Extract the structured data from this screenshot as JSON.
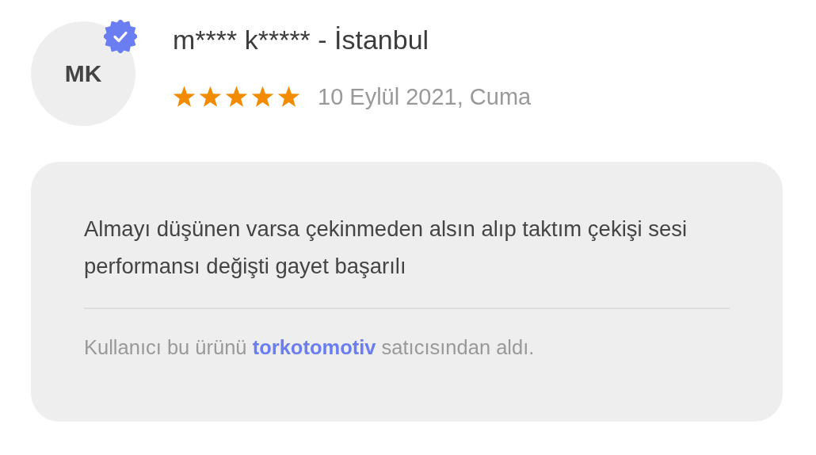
{
  "review": {
    "initials": "MK",
    "verified": true,
    "author": "m**** k***** - İstanbul",
    "stars": 5,
    "date": "10 Eylül 2021, Cuma",
    "comment": "Almayı düşünen varsa çekinmeden alsın alıp taktım çekişi sesi performansı değişti gayet başarılı",
    "purchase_note": {
      "before": "Kullanıcı bu ürünü ",
      "seller": "torkotomotiv",
      "after": " satıcısından aldı."
    }
  }
}
